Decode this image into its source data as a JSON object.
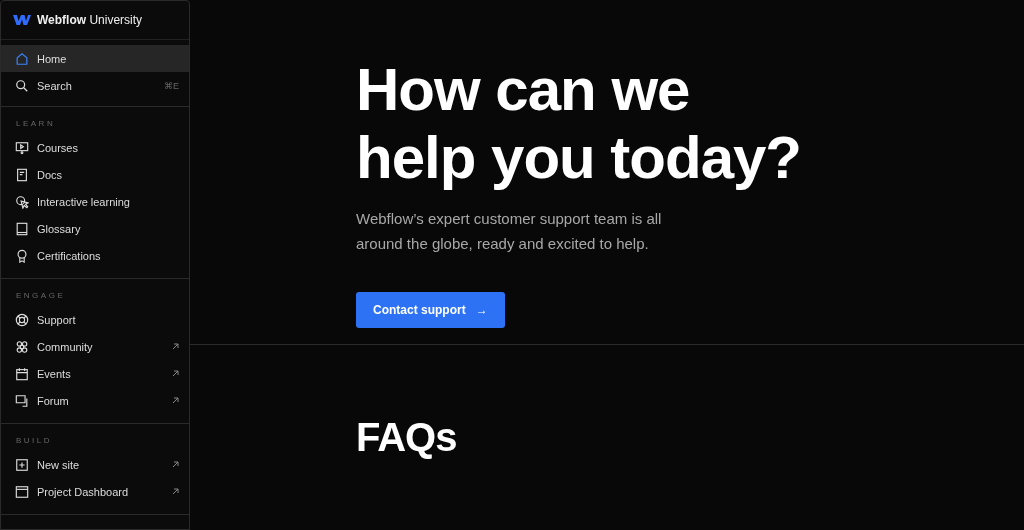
{
  "sidebar": {
    "brand": {
      "name": "Webflow",
      "suffix": "University"
    },
    "top_items": [
      {
        "label": "Home",
        "selected": true
      },
      {
        "label": "Search",
        "selected": false,
        "shortcut": "⌘E"
      }
    ],
    "sections": [
      {
        "heading": "LEARN",
        "items": [
          {
            "label": "Courses",
            "selected": false,
            "external": false
          },
          {
            "label": "Docs",
            "selected": false,
            "external": false
          },
          {
            "label": "Interactive learning",
            "selected": false,
            "external": false
          },
          {
            "label": "Glossary",
            "selected": false,
            "external": false
          },
          {
            "label": "Certifications",
            "selected": false,
            "external": false
          }
        ]
      },
      {
        "heading": "ENGAGE",
        "items": [
          {
            "label": "Support",
            "selected": false,
            "external": false
          },
          {
            "label": "Community",
            "selected": false,
            "external": true
          },
          {
            "label": "Events",
            "selected": false,
            "external": true
          },
          {
            "label": "Forum",
            "selected": false,
            "external": true
          }
        ]
      },
      {
        "heading": "BUILD",
        "items": [
          {
            "label": "New site",
            "selected": false,
            "external": true
          },
          {
            "label": "Project Dashboard",
            "selected": false,
            "external": true
          }
        ]
      }
    ]
  },
  "hero": {
    "title_lines": [
      "How can we",
      "help you today?"
    ],
    "text": "Webflow’s expert customer support team is all around the globe, ready and excited to help.",
    "button": {
      "label": "Contact support",
      "arrow": "→"
    }
  },
  "faq": {
    "heading": "FAQs"
  }
}
